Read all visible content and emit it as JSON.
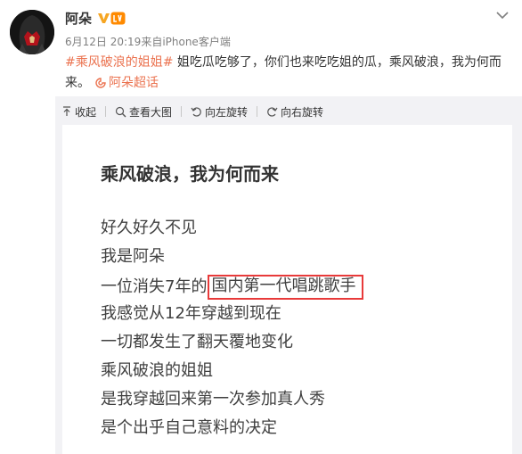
{
  "post": {
    "username": "阿朵",
    "time": "6月12日 20:19",
    "source": "来自iPhone客户端",
    "topic": "#乘风破浪的姐姐#",
    "text": " 姐吃瓜吃够了，你们也来吃吃姐的瓜，乘风破浪，我为何而来。",
    "super_topic": "阿朵超话"
  },
  "toolbar": {
    "collapse": "收起",
    "view_large": "查看大图",
    "rotate_left": "向左旋转",
    "rotate_right": "向右旋转"
  },
  "image_text": {
    "title": "乘风破浪，我为何而来",
    "lines": [
      "好久好久不见",
      "我是阿朵",
      "一位消失7年的",
      "我感觉从12年穿越到现在",
      "一切都发生了翻天覆地变化",
      "乘风破浪的姐姐",
      "是我穿越回来第一次参加真人秀",
      "是个出乎自己意料的决定"
    ],
    "highlight": "国内第一代唱跳歌手"
  },
  "colors": {
    "topic": "#eb7350",
    "highlight_box": "#e83a3a",
    "panel_bg": "#f2f2f5"
  },
  "icons": [
    "verified-v-icon",
    "level-badge-icon",
    "chevron-down-icon",
    "supertopic-icon",
    "collapse-icon",
    "zoom-icon",
    "rotate-left-icon",
    "rotate-right-icon"
  ]
}
